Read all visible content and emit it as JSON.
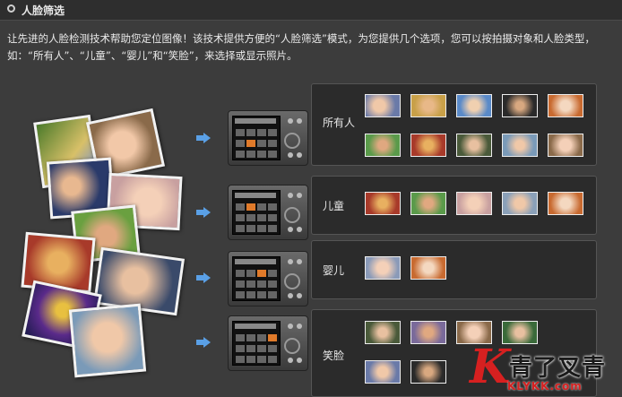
{
  "header": {
    "title": "人脸筛选"
  },
  "description": "让先进的人脸检测技术帮助您定位图像！该技术提供方便的“人脸筛选”模式，为您提供几个选项，您可以按拍摄对象和人脸类型，如：“所有人”、“儿童”、“婴儿”和“笑脸”，来选择或显示照片。",
  "rows": [
    {
      "label": "所有人"
    },
    {
      "label": "儿童"
    },
    {
      "label": "婴儿"
    },
    {
      "label": "笑脸"
    }
  ],
  "logo": {
    "cn_text": "青了叉青",
    "url_text": "KLYKK.com"
  },
  "colors": {
    "background": "#3c3c3c",
    "panel": "#2b2b2b",
    "arrow": "#5aa0e6",
    "logo_red": "#d62020"
  }
}
